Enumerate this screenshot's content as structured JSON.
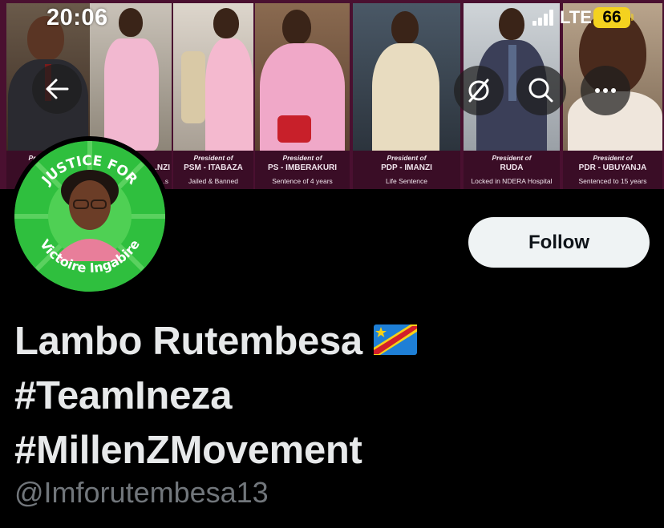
{
  "status_bar": {
    "time": "20:06",
    "network": "LTE",
    "battery": "66",
    "battery_color": "#f4d21f"
  },
  "header_buttons": {
    "back_icon": "arrow-left-icon",
    "translate_icon": "eye-slash-icon",
    "search_icon": "search-icon",
    "more_icon": "more-horizontal-icon"
  },
  "banner": {
    "panels": [
      {
        "title": "President of",
        "party": "...NZI",
        "note": "...s"
      },
      {
        "title": "President of",
        "party": "PSM - ITABAZA",
        "note": "Jailed & Banned"
      },
      {
        "title": "President of",
        "party": "PS - IMBERAKURI",
        "note": "Sentence of 4 years"
      },
      {
        "title": "President of",
        "party": "PDP - IMANZI",
        "note": "Life Sentence"
      },
      {
        "title": "President of",
        "party": "RUDA",
        "note": "Locked in NDERA Hospital"
      },
      {
        "title": "President of",
        "party": "PDR - UBUYANJA",
        "note": "Sentenced to 15 years"
      }
    ]
  },
  "avatar": {
    "top_text": "JUSTICE FOR",
    "bottom_text": "Victoire Ingabire",
    "ring_color": "#2fbf3e"
  },
  "profile": {
    "follow_label": "Follow",
    "name_line1": "Lambo Rutembesa",
    "name_line2": "#TeamIneza",
    "name_line3": "#MillenZMovement",
    "flag_icon": "drc-flag-icon",
    "handle": "@Imforutembesa13"
  }
}
